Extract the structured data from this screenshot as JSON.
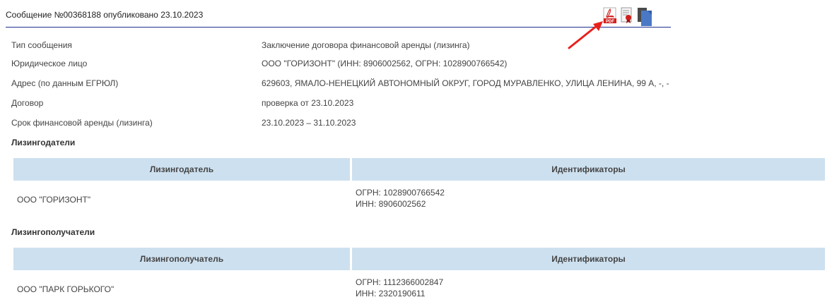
{
  "header": {
    "title": "Сообщение №00368188 опубликовано 23.10.2023",
    "icons": [
      "pdf-icon",
      "certificate-icon",
      "copy-document-icon"
    ]
  },
  "fields": [
    {
      "label": "Тип сообщения",
      "value": "Заключение договора финансовой аренды (лизинга)"
    },
    {
      "label": "Юридическое лицо",
      "value": "ООО \"ГОРИЗОНТ\" (ИНН: 8906002562, ОГРН: 1028900766542)"
    },
    {
      "label": "Адрес (по данным ЕГРЮЛ)",
      "value": "629603, ЯМАЛО-НЕНЕЦКИЙ АВТОНОМНЫЙ ОКРУГ, ГОРОД МУРАВЛЕНКО, УЛИЦА ЛЕНИНА, 99 А, -, -"
    },
    {
      "label": "Договор",
      "value": "проверка от 23.10.2023"
    },
    {
      "label": "Срок финансовой аренды (лизинга)",
      "value": "23.10.2023 – 31.10.2023"
    }
  ],
  "lessors": {
    "title": "Лизингодатели",
    "columns": [
      "Лизингодатель",
      "Идентификаторы"
    ],
    "rows": [
      {
        "name": "ООО \"ГОРИЗОНТ\"",
        "ogrn": "ОГРН: 1028900766542",
        "inn": "ИНН: 8906002562"
      }
    ]
  },
  "lessees": {
    "title": "Лизингополучатели",
    "columns": [
      "Лизингополучатель",
      "Идентификаторы"
    ],
    "rows": [
      {
        "name": "ООО \"ПАРК ГОРЬКОГО\"",
        "ogrn": "ОГРН: 1112366002847",
        "inn": "ИНН: 2320190611"
      }
    ]
  },
  "colors": {
    "header_rule": "#1f2f8f",
    "table_header_bg": "#cde0ef",
    "arrow": "#e8201c"
  }
}
